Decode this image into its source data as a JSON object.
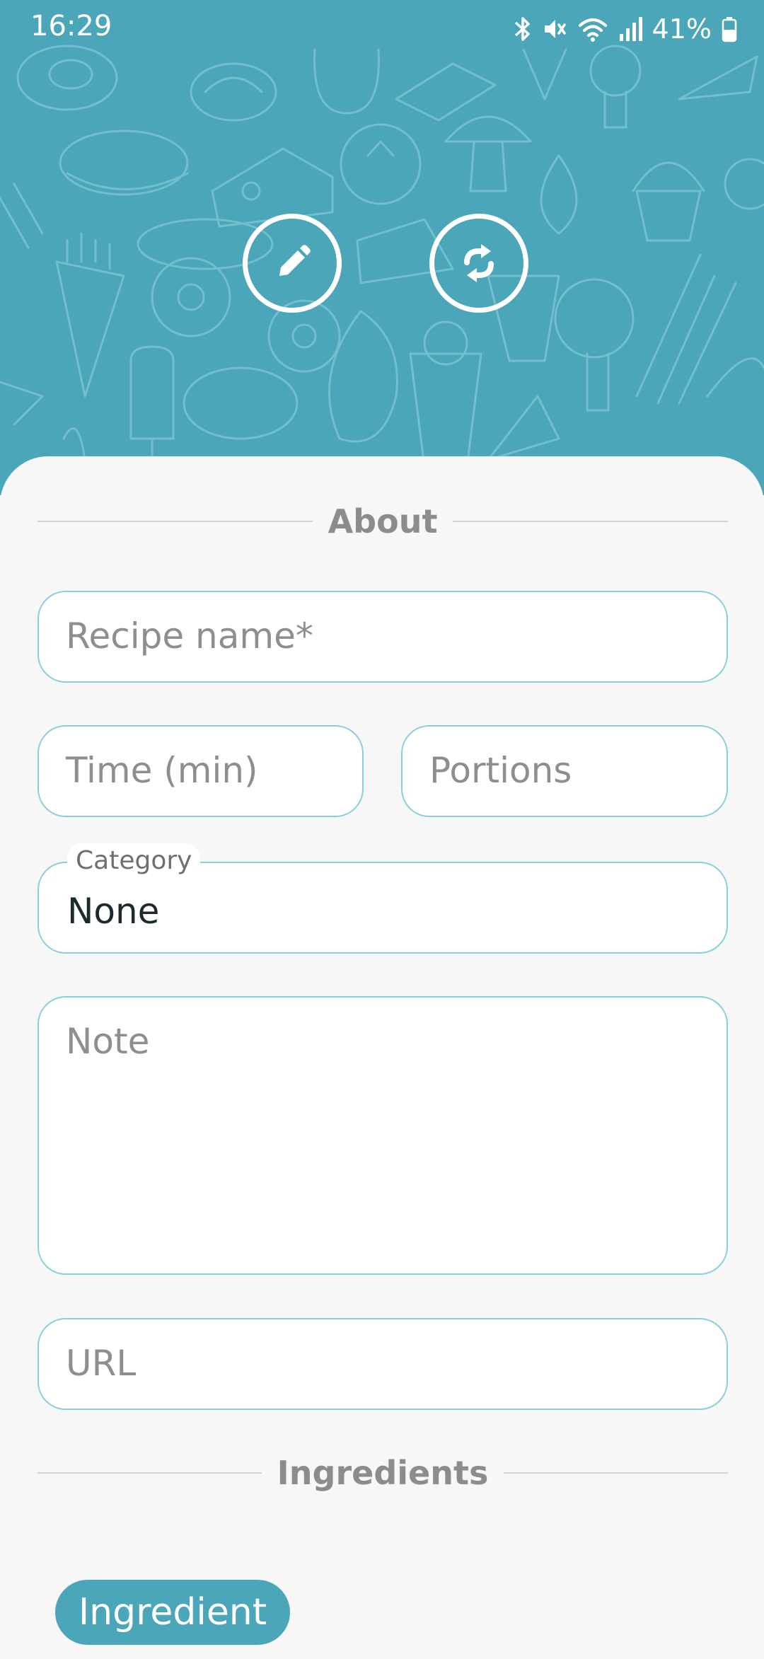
{
  "status_bar": {
    "time": "16:29",
    "battery": "41%",
    "icons": [
      "bluetooth-icon",
      "mute-icon",
      "wifi-icon",
      "signal-icon",
      "battery-icon"
    ]
  },
  "header": {
    "background_color": "#4ba6b9",
    "buttons": [
      "pencil-icon",
      "sync-icon"
    ]
  },
  "sections": {
    "about": "About",
    "ingredients": "Ingredients"
  },
  "form": {
    "recipe_name_placeholder": "Recipe name*",
    "time_placeholder": "Time (min)",
    "portions_placeholder": "Portions",
    "category_label": "Category",
    "category_value": "None",
    "note_placeholder": "Note",
    "url_placeholder": "URL"
  },
  "ingredient_chip": "Ingredient",
  "colors": {
    "accent": "#4ba6b9",
    "field_border": "#86cfdb",
    "sheet_background": "#f7f7f7"
  }
}
